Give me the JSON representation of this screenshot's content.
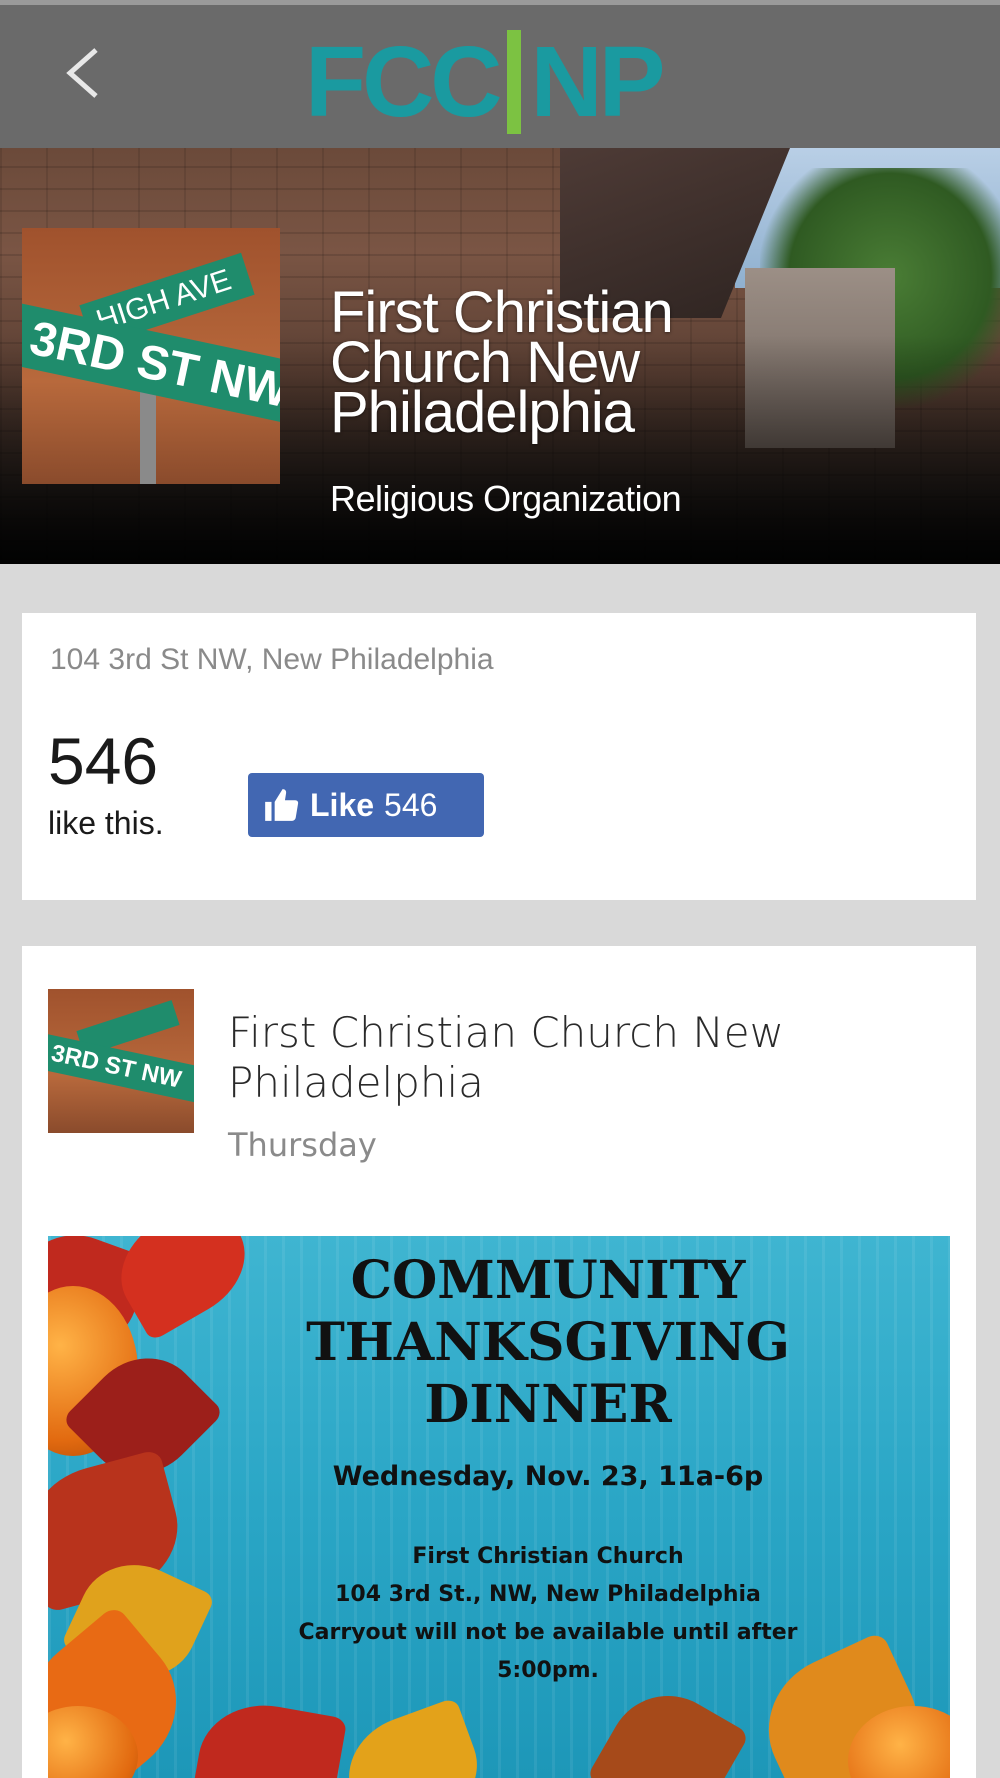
{
  "header": {
    "back_icon": "chevron-left-icon",
    "logo_left": "FCC",
    "logo_right": "NP",
    "colors": {
      "bar_bg": "#6a6a6a",
      "logo_teal": "#1a9aa0",
      "logo_green": "#7cc242"
    }
  },
  "hero": {
    "thumb_sign_top": "HIGH AVE",
    "thumb_sign_main": "3RD ST NW",
    "title": "First Christian Church New Philadelphia",
    "subtitle": "Religious Organization"
  },
  "info": {
    "address": "104 3rd St NW, New Philadelphia",
    "like_count": "546",
    "like_text": "like this.",
    "like_button": {
      "label": "Like",
      "count": "546",
      "icon": "thumbs-up-icon",
      "color": "#4267b2"
    }
  },
  "post": {
    "author": "First Christian Church New Philadelphia",
    "time": "Thursday",
    "avatar_sign": "3RD ST NW",
    "flyer": {
      "title_lines": [
        "COMMUNITY",
        "THANKSGIVING",
        "DINNER"
      ],
      "date": "Wednesday, Nov. 23, 11a-6p",
      "details": [
        "First Christian Church",
        "104 3rd St., NW, New Philadelphia",
        "Carryout will not be available until after",
        "5:00pm."
      ]
    }
  }
}
